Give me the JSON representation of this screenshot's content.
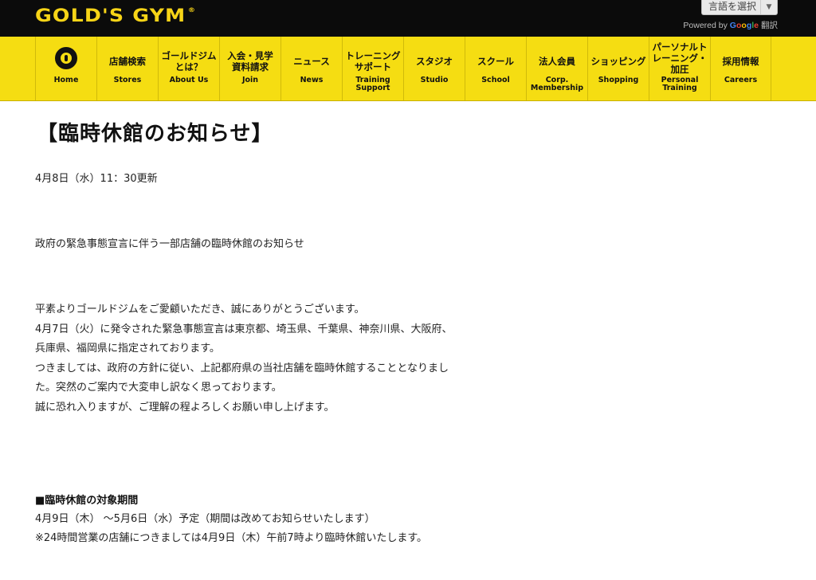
{
  "header": {
    "logo_text": "GOLD'S GYM",
    "logo_tm": "®",
    "translate_label": "言語を選択",
    "powered_by_prefix": "Powered by",
    "powered_by_suffix": "翻訳",
    "google": [
      "G",
      "o",
      "o",
      "g",
      "l",
      "e"
    ]
  },
  "nav": {
    "items": [
      {
        "jp": "",
        "en": "Home"
      },
      {
        "jp": "店舗検索",
        "en": "Stores"
      },
      {
        "jp": "ゴールドジム\nとは？",
        "en": "About Us"
      },
      {
        "jp": "入会・見学\n資料請求",
        "en": "Join"
      },
      {
        "jp": "ニュース",
        "en": "News"
      },
      {
        "jp": "トレーニング\nサポート",
        "en": "Training\nSupport"
      },
      {
        "jp": "スタジオ",
        "en": "Studio"
      },
      {
        "jp": "スクール",
        "en": "School"
      },
      {
        "jp": "法人会員",
        "en": "Corp.\nMembership"
      },
      {
        "jp": "ショッピング",
        "en": "Shopping"
      },
      {
        "jp": "パーソナルト\nレーニング・\n加圧",
        "en": "Personal\nTraining"
      },
      {
        "jp": "採用情報",
        "en": "Careers"
      }
    ]
  },
  "main": {
    "title": "【臨時休館のお知らせ】",
    "updated": "4月8日（水）11：30更新",
    "subtitle": "政府の緊急事態宣言に伴う一部店舗の臨時休館のお知らせ",
    "body_lines": [
      "平素よりゴールドジムをご愛顧いただき、誠にありがとうございます。",
      "4月7日（火）に発令された緊急事態宣言は東京都、埼玉県、千葉県、神奈川県、大阪府、",
      "兵庫県、福岡県に指定されております。",
      "つきましては、政府の方針に従い、上記都府県の当社店舗を臨時休館することとなりまし",
      "た。突然のご案内で大変申し訳なく思っております。",
      "誠に恐れ入りますが、ご理解の程よろしくお願い申し上げます。"
    ],
    "section_heading": "■臨時休館の対象期間",
    "period_lines": [
      "4月9日（木） ～5月6日（水）予定（期間は改めてお知らせいたします）",
      "※24時間営業の店舗につきましては4月9日（木）午前7時より臨時休館いたします。"
    ]
  },
  "colors": {
    "brand_yellow": "#f5dd12",
    "header_black": "#0b0b0b"
  }
}
